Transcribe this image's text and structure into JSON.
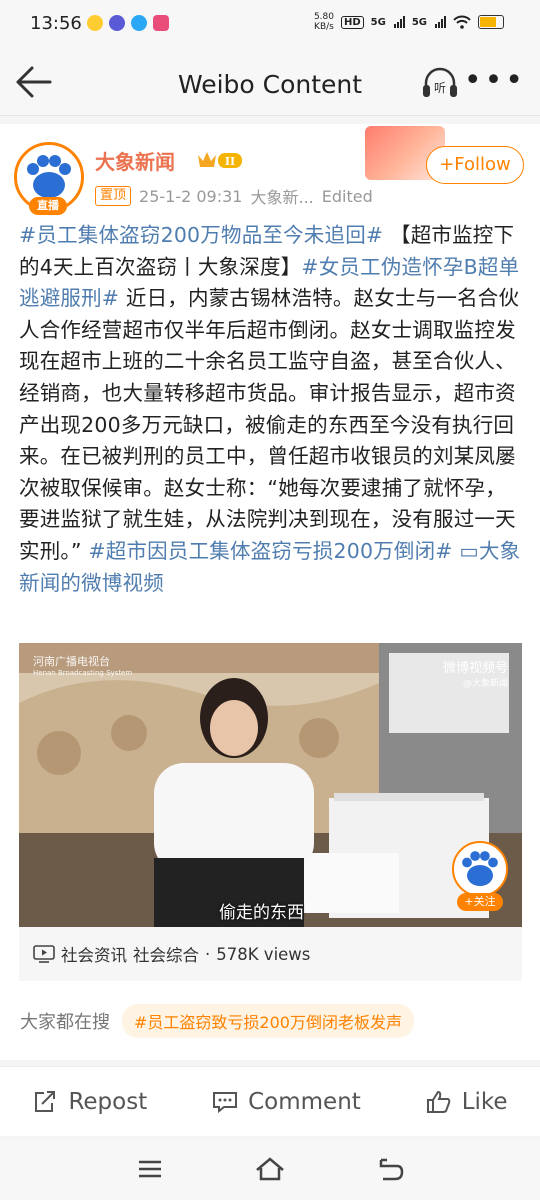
{
  "status_bar": {
    "time": "13:56",
    "net_speed_value": "5.80",
    "net_speed_unit": "KB/s",
    "hd": "HD",
    "sig1": "5G",
    "sig2": "5G"
  },
  "header": {
    "title": "Weibo Content",
    "listen_label": "听"
  },
  "post": {
    "author": "大象新闻",
    "vip_level": "II",
    "live_tag": "直播",
    "pinned": "置顶",
    "date": "25-1-2 09:31",
    "source": "大象新...",
    "edited": "Edited",
    "follow_label": "+Follow",
    "content": [
      {
        "t": "tag",
        "v": "#员工集体盗窃200万物品至今未追回#"
      },
      {
        "t": "text",
        "v": " 【超市监控下的4天上百次盗窃丨大象深度】"
      },
      {
        "t": "tag",
        "v": "#女员工伪造怀孕B超单逃避服刑#"
      },
      {
        "t": "text",
        "v": " 近日，内蒙古锡林浩特。赵女士与一名合伙人合作经营超市仅半年后超市倒闭。赵女士调取监控发现在超市上班的二十余名员工监守自盗，甚至合伙人、经销商，也大量转移超市货品。审计报告显示，超市资产出现200多万元缺口，被偷走的东西至今没有执行回来。在已被判刑的员工中，曾任超市收银员的刘某凤屡次被取保候审。赵女士称：“她每次要逮捕了就怀孕，要进监狱了就生娃，从法院判决到现在，没有服过一天实刑。” "
      },
      {
        "t": "tag",
        "v": "#超市因员工集体盗窃亏损200万倒闭#"
      },
      {
        "t": "text",
        "v": " "
      },
      {
        "t": "tag",
        "v": "▭大象新闻的微博视频"
      }
    ],
    "video": {
      "channel_logo": "河南广播电视台",
      "channel_logo_en": "Henan Broadcasting System",
      "watermark": "微博视频号",
      "watermark_sub": "@大象新闻",
      "subtitle": "偷走的东西",
      "follow_label": "+关注"
    },
    "video_info": {
      "category1": "社会资讯",
      "category2": "社会综合",
      "separator": "·",
      "views": "578K views"
    },
    "search": {
      "label": "大家都在搜",
      "chip": "#员工盗窃致亏损200万倒闭老板发声"
    }
  },
  "actions": {
    "repost": "Repost",
    "comment": "Comment",
    "like": "Like"
  },
  "colors": {
    "accent": "#ff8200",
    "link": "#507daf",
    "author": "#eb7350"
  }
}
